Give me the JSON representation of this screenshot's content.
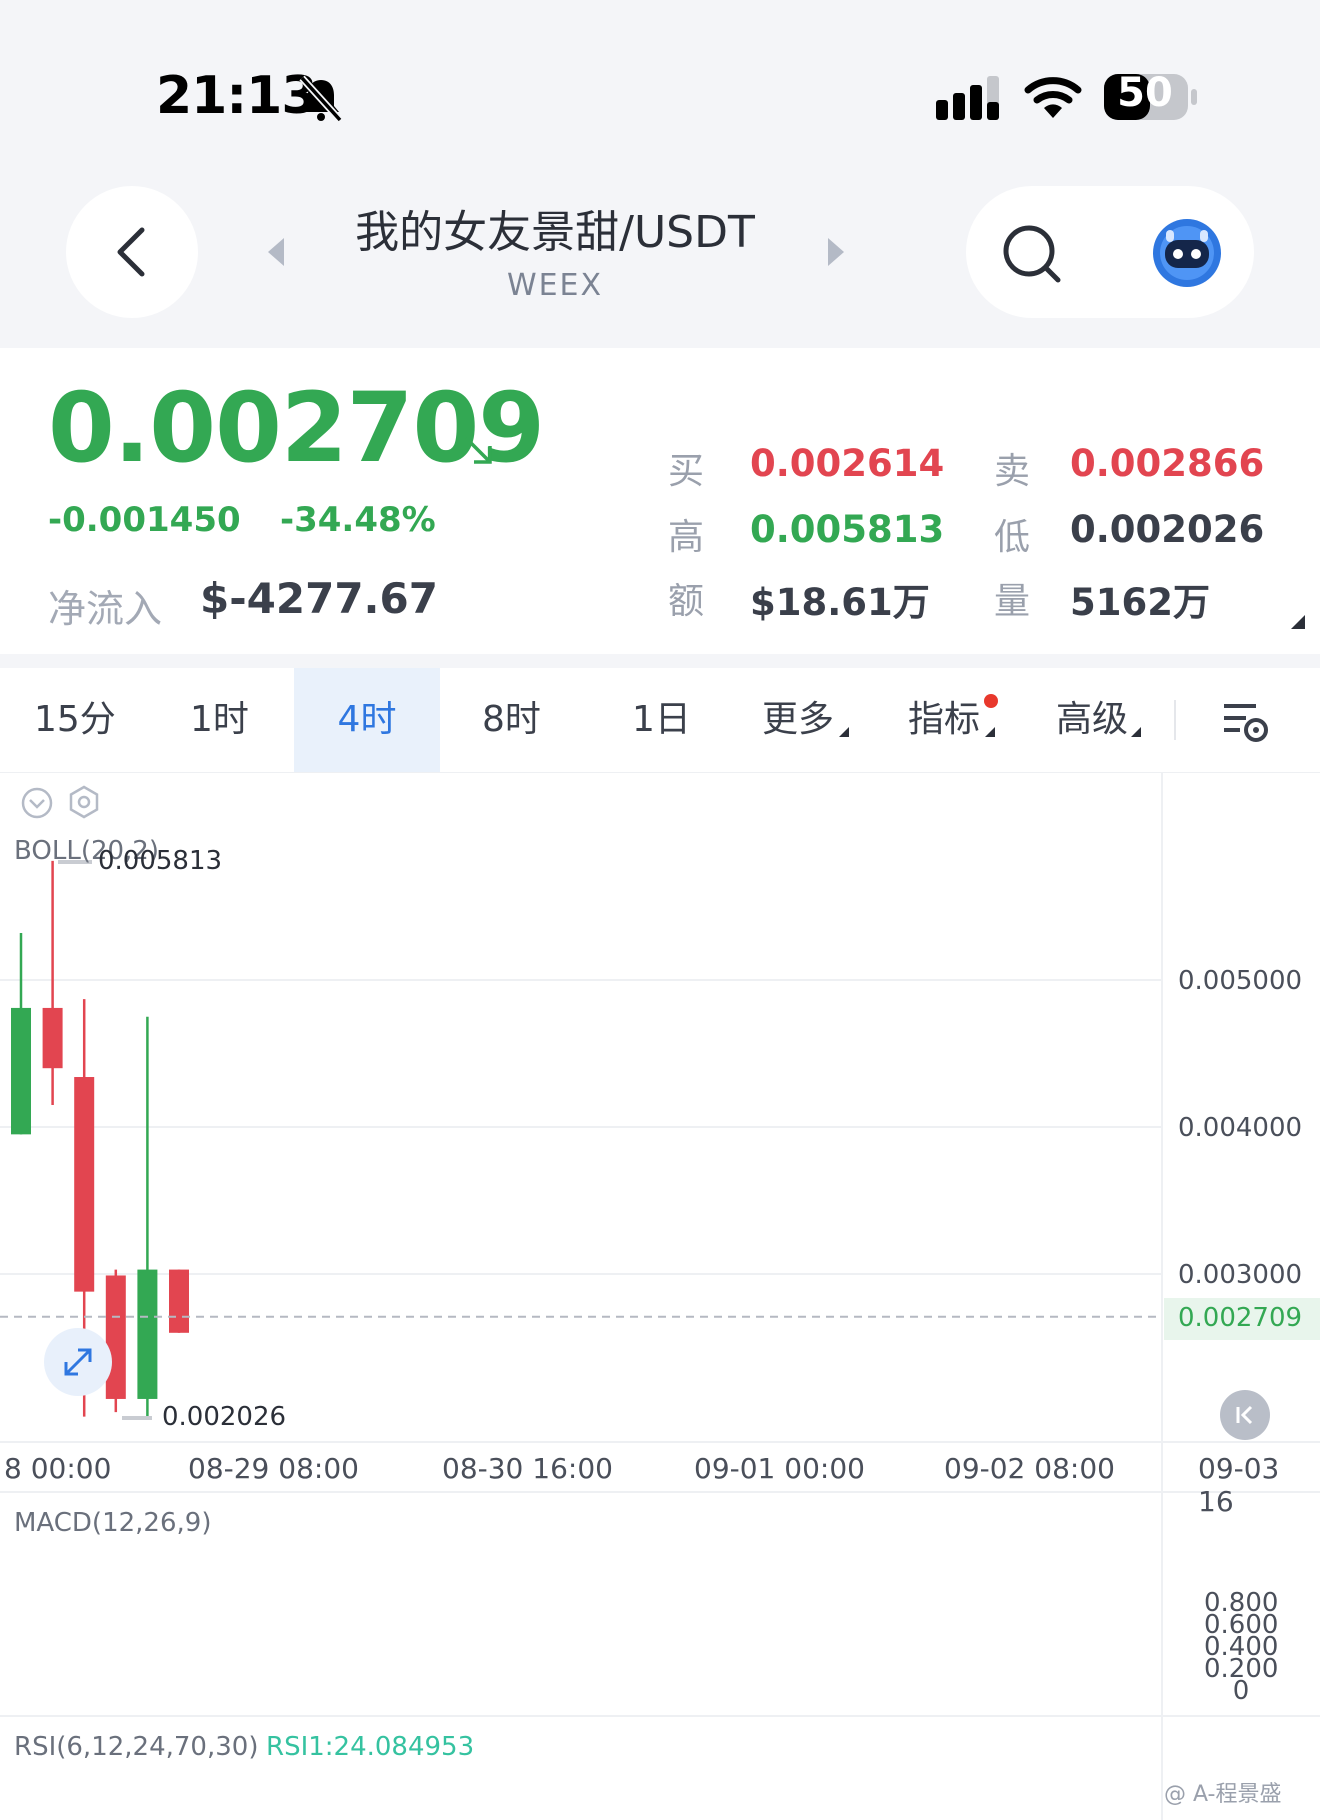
{
  "status_bar": {
    "time": "21:13",
    "battery": "50"
  },
  "header": {
    "pair": "我的女友景甜/USDT",
    "exchange": "WEEX"
  },
  "ticker": {
    "last_price": "0.002709",
    "change": "-0.001450",
    "change_pct": "-34.48%",
    "net_inflow_label": "净流入",
    "net_inflow_value": "$-4277.67"
  },
  "stats": {
    "buy_label": "买",
    "buy_value": "0.002614",
    "sell_label": "卖",
    "sell_value": "0.002866",
    "high_label": "高",
    "high_value": "0.005813",
    "low_label": "低",
    "low_value": "0.002026",
    "amount_label": "额",
    "amount_value": "$18.61万",
    "volume_label": "量",
    "volume_value": "5162万"
  },
  "tabs": [
    "15分",
    "1时",
    "4时",
    "8时",
    "1日",
    "更多",
    "指标",
    "高级"
  ],
  "active_tab": "4时",
  "indicator_labels": {
    "boll": "BOLL(20,2)",
    "macd": "MACD(12,26,9)",
    "rsi": "RSI(6,12,24,70,30)",
    "rsi1": "RSI1:24.084953"
  },
  "watermark": "@ A-程景盛",
  "colors": {
    "up": "#33a853",
    "down": "#e24550",
    "accent": "#2f77e0"
  },
  "icons": [
    "back-icon",
    "prev-pair-icon",
    "next-pair-icon",
    "search-icon",
    "robot-avatar-icon",
    "signal-icon",
    "wifi-icon",
    "battery-icon",
    "bell-muted-icon",
    "chart-settings-icon",
    "expand-icon",
    "scroll-latest-icon"
  ],
  "chart_data": {
    "type": "candlestick",
    "y_ticks": [
      "0.005000",
      "0.004000",
      "0.003000"
    ],
    "current_price_tag": "0.002709",
    "high_marker": "0.005813",
    "low_marker": "0.002026",
    "x_ticks": [
      "8 00:00",
      "08-29 08:00",
      "08-30 16:00",
      "09-01 00:00",
      "09-02 08:00",
      "09-03 16"
    ],
    "ylim": [
      0.00195,
      0.00595
    ],
    "candles": [
      {
        "open": 0.00395,
        "high": 0.00532,
        "low": 0.00395,
        "close": 0.00481
      },
      {
        "open": 0.00481,
        "high": 0.00581,
        "low": 0.00415,
        "close": 0.0044
      },
      {
        "open": 0.00434,
        "high": 0.00487,
        "low": 0.00203,
        "close": 0.00288
      },
      {
        "open": 0.00299,
        "high": 0.00303,
        "low": 0.00206,
        "close": 0.00215
      },
      {
        "open": 0.00215,
        "high": 0.00475,
        "low": 0.00202,
        "close": 0.00303
      },
      {
        "open": 0.00303,
        "high": 0.00303,
        "low": 0.0026,
        "close": 0.0026
      }
    ],
    "macd_ticks": [
      "0.800",
      "0.600",
      "0.400",
      "0.200",
      "0"
    ]
  }
}
